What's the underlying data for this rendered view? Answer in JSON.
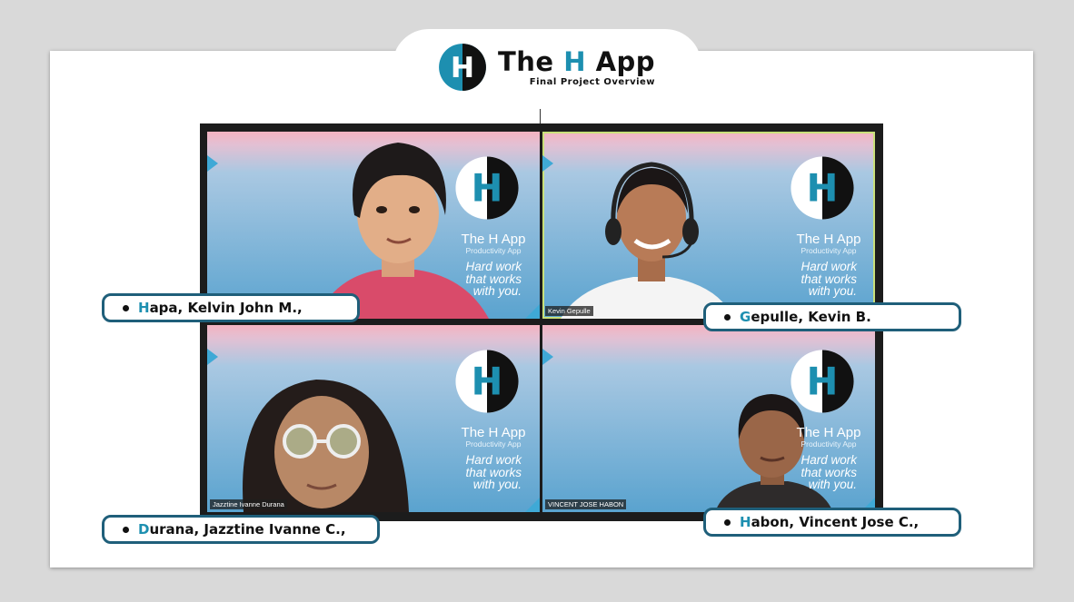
{
  "header": {
    "title_prefix": "The ",
    "title_accent": "H",
    "title_suffix": " App",
    "subtitle": "Final Project Overview",
    "logo_letter": "H"
  },
  "tile_branding": {
    "logo_letter": "H",
    "app_name": "The H App",
    "app_type": "Productivity App",
    "slogan_1": "Hard work",
    "slogan_2": "that works",
    "slogan_3": "with you."
  },
  "participants": [
    {
      "tag": "",
      "label_initial": "H",
      "label_rest": "apa, Kelvin John M.,"
    },
    {
      "tag": "Kevin Gepulle",
      "label_initial": "G",
      "label_rest": "epulle, Kevin B."
    },
    {
      "tag": "Jazztine Ivanne Durana",
      "label_initial": "D",
      "label_rest": "urana, Jazztine Ivanne C.,"
    },
    {
      "tag": "VINCENT JOSE HABON",
      "label_initial": "H",
      "label_rest": "abon, Vincent Jose C.,"
    }
  ],
  "colors": {
    "accent": "#1d8fb0",
    "label_border": "#1f5f7a",
    "tile_accent": "#3fa9d6",
    "active_speaker_border": "#c9e07a"
  }
}
